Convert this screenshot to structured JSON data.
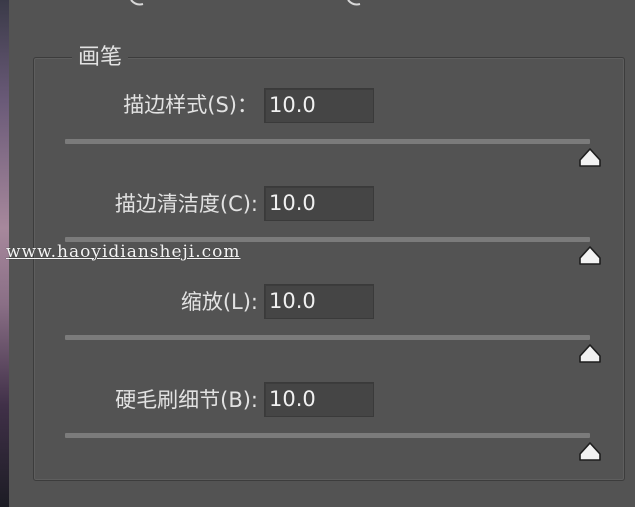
{
  "panel": {
    "group_title": "画笔",
    "fields": [
      {
        "label": "描边样式(S)：",
        "value": "10.0",
        "slider": 1.0
      },
      {
        "label": "描边清洁度(C):",
        "value": "10.0",
        "slider": 1.0
      },
      {
        "label": "缩放(L):",
        "value": "10.0",
        "slider": 1.0
      },
      {
        "label": "硬毛刷细节(B):",
        "value": "10.0",
        "slider": 1.0
      }
    ]
  },
  "watermark": "www.haoyidiansheji.com",
  "colors": {
    "background": "#535353",
    "input_background": "#454545",
    "text": "#e2e2e2",
    "track": "#7b7b7b"
  }
}
